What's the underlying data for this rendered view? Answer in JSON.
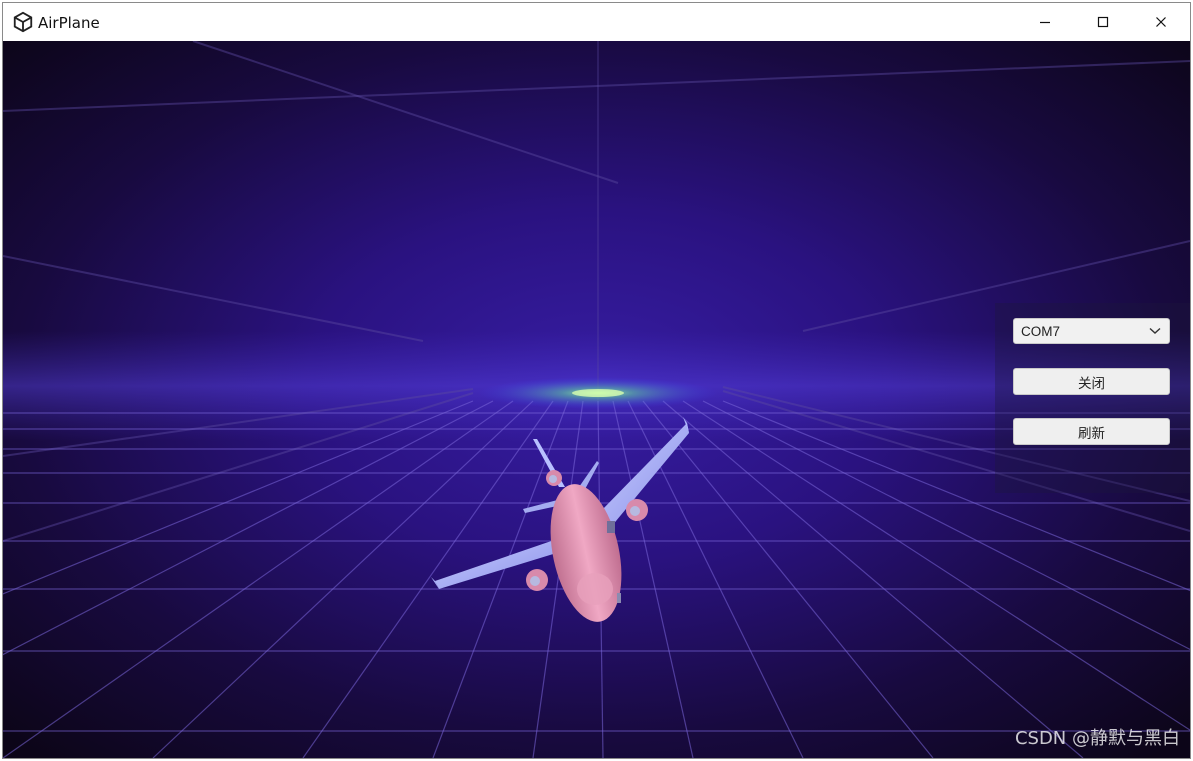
{
  "window": {
    "title": "AirPlane",
    "icon": "unity-logo-icon",
    "controls": [
      "minimize-icon",
      "maximize-icon",
      "close-icon"
    ]
  },
  "controls": {
    "port_dropdown": {
      "selected": "COM7"
    },
    "close_button_label": "关闭",
    "refresh_button_label": "刷新"
  },
  "watermark": "CSDN @静默与黑白",
  "scene": {
    "subject": "airplane-3d-model",
    "colors": {
      "background": "#120825",
      "grid": "#6a57c9",
      "glow": "#7cff8a",
      "fuselage": "#e79bb8",
      "wings": "#a9b3ff"
    }
  }
}
